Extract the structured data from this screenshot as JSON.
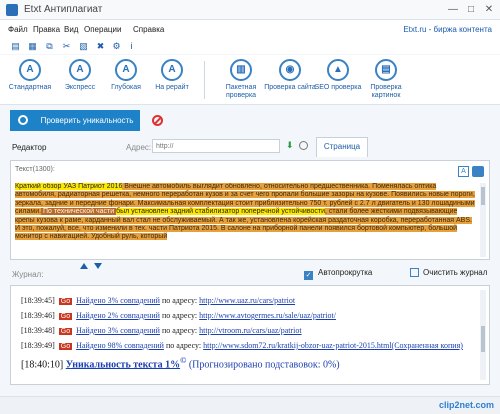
{
  "window": {
    "title": "Etxt Антиплагиат"
  },
  "menu": {
    "items": [
      "Файл",
      "Правка",
      "Вид",
      "Операции",
      "Справка"
    ],
    "right_link": "Etxt.ru - биржа контента"
  },
  "small_toolbar": {
    "icons": [
      "folder-icon",
      "save-icon",
      "copy-icon",
      "cut-icon",
      "clipboard-icon",
      "delete-icon",
      "settings-icon",
      "info-icon"
    ]
  },
  "ribbon": {
    "check_modes": [
      "Стандартная",
      "Экспресс",
      "Глубокая",
      "На рерайт"
    ],
    "web_checks": [
      "Пакетная проверка",
      "Проверка сайта",
      "SEO проверка",
      "Проверка картинок"
    ]
  },
  "check": {
    "button_label": "Проверить уникальность"
  },
  "editor": {
    "label": "Редактор",
    "address_label": "Адрес:",
    "address_placeholder": "http://",
    "page_tab": "Страница"
  },
  "text_panel": {
    "label": "Текст(1300):",
    "segments": [
      {
        "style": "hl-y",
        "text": "Краткий обзор УАЗ Патриот 2016"
      },
      {
        "style": "hl-o",
        "text": " Внешне автомобиль выглядит обновлено, относительно предшественника. Поменялась оптика автомобиля, радиаторная решетка, немного переработан кузов и за счет чего пропали большие зазоры на кузове. Появились новые пороги, зеркала, задние и передние фонари. Максимальная комплектация стоит приблизительно 750 т. рублей с 2.7 л двигатель и 130 лошадиными силами."
      },
      {
        "style": "hl-b",
        "text": " По технической части "
      },
      {
        "style": "hl-y",
        "text": "был установлен задний стабилизатор поперечной устойчивости"
      },
      {
        "style": "hl-o",
        "text": ", стали более жесткими подвязывающие крепы кузова к раме, карданный вал стал не обслуживаемый. А так же, установлена корейская раздаточная коробка, переработанная ABS. И это, пожалуй, все, что изменили в тех. части Патриота 2015."
      },
      {
        "style": "hl-o",
        "text": " В салоне на приборной панели появился бортовой компьютер, большой монитор с навигацией. Удобный руль, который"
      }
    ]
  },
  "journal": {
    "label": "Журнал:",
    "autoscroll_label": "Автопрокрутка",
    "clear_label": "Очистить журнал",
    "go_label": "Go",
    "entries": [
      {
        "time": "[18:39:45]",
        "found": "Найдено 3% совпадений",
        "by": "по адресу:",
        "url": "http://www.uaz.ru/cars/patriot"
      },
      {
        "time": "[18:39:46]",
        "found": "Найдено 2% совпадений",
        "by": "по адресу:",
        "url": "http://www.avtogermes.ru/sale/uaz/patriot/"
      },
      {
        "time": "[18:39:48]",
        "found": "Найдено 3% совпадений",
        "by": "по адресу:",
        "url": "http://vtroom.ru/cars/uaz/patriot"
      },
      {
        "time": "[18:39:49]",
        "found": "Найдено 98% совпадений",
        "by": "по адресу:",
        "url": "http://www.sdom72.ru/kratkij-obzor-uaz-patriot-2015.html(Сохраненная копия)"
      }
    ],
    "final": {
      "time": "[18:40:10]",
      "uniqueness": "Уникальность текста 1%",
      "sup": "©",
      "substituted": "(Прогнозировано подставовок: 0%)"
    }
  },
  "watermark": "clip2net.com",
  "colors": {
    "accent": "#1d82c8",
    "highlight_orange": "#e8a03c",
    "highlight_brown": "#b86a2a",
    "highlight_yellow": "#ffe800",
    "go_red": "#c8361e"
  }
}
